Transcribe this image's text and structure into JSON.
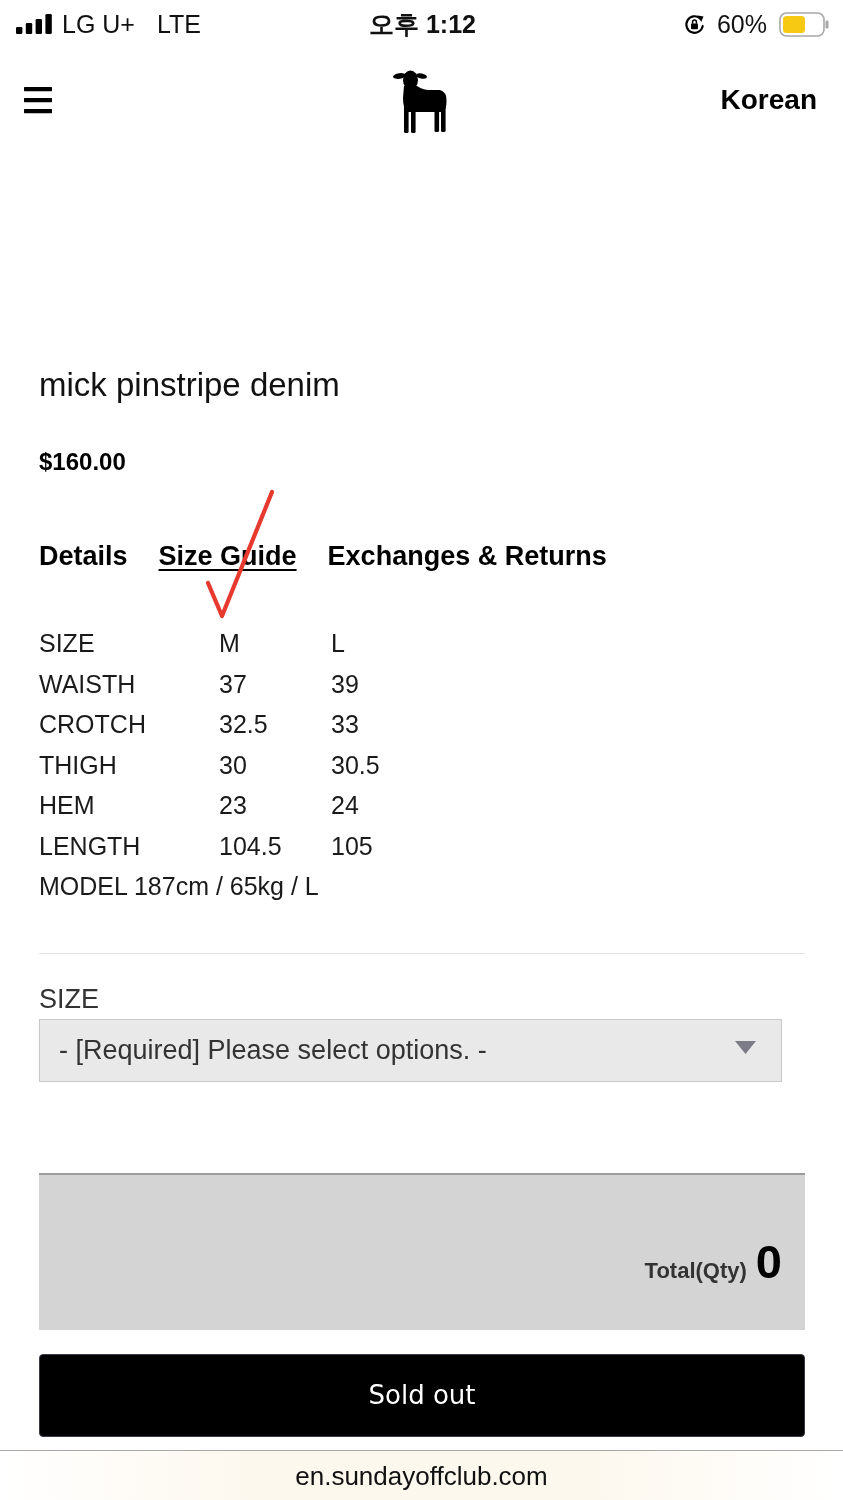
{
  "status_bar": {
    "carrier": "LG U+",
    "network": "LTE",
    "time": "오후 1:12",
    "battery": "60%"
  },
  "header": {
    "language": "Korean"
  },
  "product": {
    "name": "mick pinstripe denim",
    "price": "$160.00"
  },
  "tabs": [
    {
      "label": "Details",
      "selected": false
    },
    {
      "label": "Size Guide",
      "selected": true
    },
    {
      "label": "Exchanges & Returns",
      "selected": false
    }
  ],
  "annotations": [
    {
      "kind": "check"
    }
  ],
  "size_table": {
    "rows": [
      [
        "SIZE",
        "M",
        "L"
      ],
      [
        "WAISTH",
        "37",
        "39"
      ],
      [
        "CROTCH",
        "32.5",
        "33"
      ],
      [
        "THIGH",
        "30",
        "30.5"
      ],
      [
        "HEM",
        "23",
        "24"
      ],
      [
        "LENGTH",
        "104.5",
        "105"
      ]
    ],
    "note": "MODEL 187cm / 65kg / L"
  },
  "option": {
    "label": "SIZE",
    "value": "- [Required] Please select options. -"
  },
  "total": {
    "label": "Total(Qty)",
    "quantity": "0"
  },
  "buy_button": {
    "label": "Sold out"
  },
  "url_bar": {
    "address": "en.sundayoffclub.com"
  }
}
